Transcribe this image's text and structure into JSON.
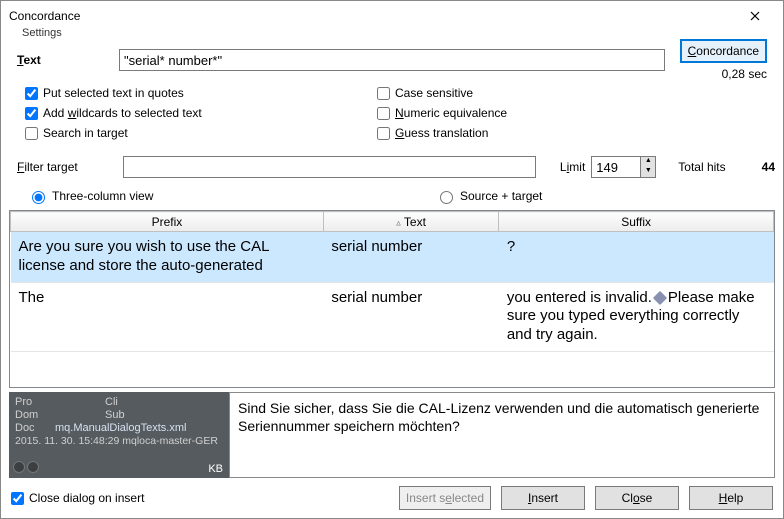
{
  "window": {
    "title": "Concordance"
  },
  "settings": {
    "group_label": "Settings",
    "text_label": "Text",
    "text_value": "\"serial* number*\"",
    "concordance_btn": "Concordance",
    "timer": "0,28 sec",
    "opts": {
      "put_quotes": "Put selected text in quotes",
      "add_wildcards": "Add wildcards to selected text",
      "search_target": "Search in target",
      "case_sensitive": "Case sensitive",
      "numeric_equiv": "Numeric equivalence",
      "guess_translation": "Guess translation"
    },
    "filter_label": "Filter target",
    "filter_value": "",
    "limit_label": "Limit",
    "limit_value": "149",
    "total_hits_label": "Total hits",
    "total_hits_value": "44"
  },
  "view": {
    "three_col": "Three-column view",
    "source_target": "Source + target"
  },
  "table": {
    "cols": {
      "prefix": "Prefix",
      "text": "Text",
      "suffix": "Suffix"
    },
    "rows": [
      {
        "prefix": "Are you sure you wish to use the CAL license and store the auto-generated",
        "text": "serial number",
        "suffix": "?",
        "selected": true
      },
      {
        "prefix": "The",
        "text": "serial number",
        "suffix_pre": " you entered is invalid.",
        "suffix_post": "Please make sure you typed everything correctly and try again."
      }
    ]
  },
  "detail": {
    "meta": {
      "pro": "Pro",
      "cli": "Cli",
      "dom": "Dom",
      "sub": "Sub",
      "doc_label": "Doc",
      "doc_value": "mq.ManualDialogTexts.xml",
      "timestamp": "2015. 11. 30. 15:48:29 mqloca-master-GER",
      "kb": "KB"
    },
    "translation": "Sind Sie sicher, dass Sie die CAL-Lizenz verwenden und die automatisch generierte Seriennummer speichern möchten?"
  },
  "bottom": {
    "close_on_insert": "Close dialog on insert",
    "insert_selected": "Insert selected",
    "insert": "Insert",
    "close": "Close",
    "help": "Help"
  }
}
